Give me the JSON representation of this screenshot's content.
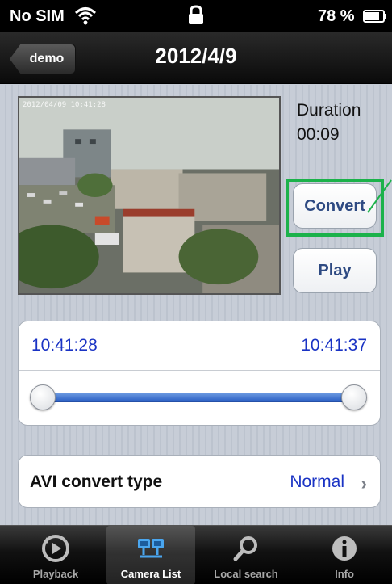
{
  "status_bar": {
    "carrier": "No SIM",
    "battery_percent": "78 %"
  },
  "nav": {
    "back_label": "demo",
    "title": "2012/4/9"
  },
  "video": {
    "timestamp": "2012/04/09 10:41:28"
  },
  "duration": {
    "label": "Duration",
    "value": "00:09"
  },
  "buttons": {
    "convert": "Convert",
    "play": "Play"
  },
  "range": {
    "start": "10:41:28",
    "end": "10:41:37",
    "start_fraction": 0.0,
    "end_fraction": 1.0
  },
  "avi": {
    "label": "AVI convert type",
    "value": "Normal"
  },
  "tabs": [
    {
      "label": "Playback",
      "icon": "playback-icon",
      "selected": false
    },
    {
      "label": "Camera List",
      "icon": "camera-list-icon",
      "selected": true
    },
    {
      "label": "Local search",
      "icon": "search-icon",
      "selected": false
    },
    {
      "label": "Info",
      "icon": "info-icon",
      "selected": false
    }
  ],
  "colors": {
    "accent_blue": "#1a33c4",
    "highlight_green": "#1bb24a",
    "button_text": "#2e4a82"
  }
}
